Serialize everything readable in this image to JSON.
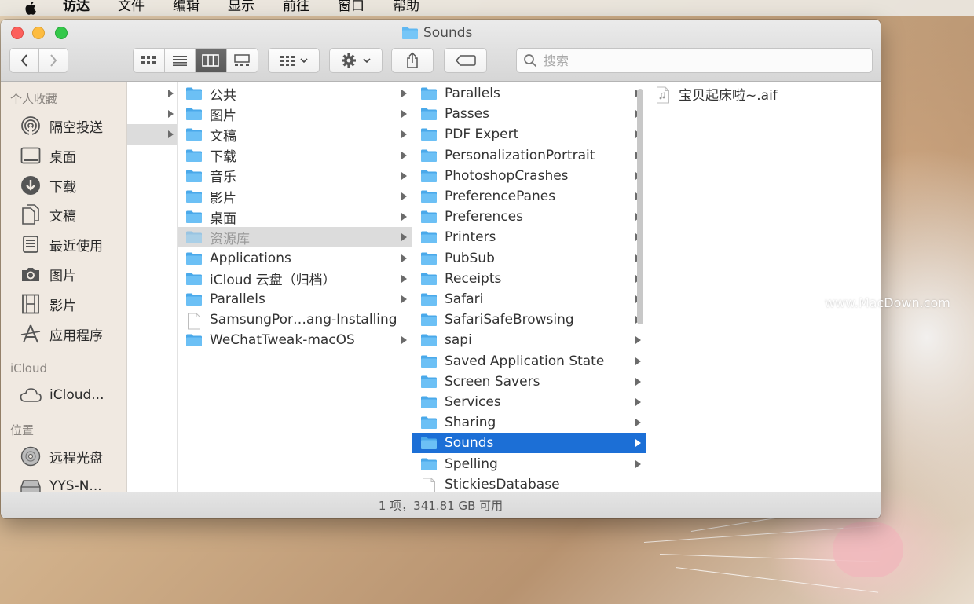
{
  "menubar": {
    "items": [
      "访达",
      "文件",
      "编辑",
      "显示",
      "前往",
      "窗口",
      "帮助"
    ]
  },
  "window": {
    "title": "Sounds"
  },
  "toolbar": {
    "search_placeholder": "搜索",
    "view_mode_active": "column"
  },
  "sidebar": {
    "sections": [
      {
        "header": "个人收藏",
        "items": [
          {
            "label": "隔空投送",
            "icon": "airdrop-icon"
          },
          {
            "label": "桌面",
            "icon": "desktop-icon"
          },
          {
            "label": "下载",
            "icon": "download-icon"
          },
          {
            "label": "文稿",
            "icon": "documents-icon"
          },
          {
            "label": "最近使用",
            "icon": "recents-icon"
          },
          {
            "label": "图片",
            "icon": "camera-icon"
          },
          {
            "label": "影片",
            "icon": "film-icon"
          },
          {
            "label": "应用程序",
            "icon": "applications-icon"
          }
        ]
      },
      {
        "header": "iCloud",
        "items": [
          {
            "label": "iCloud...",
            "icon": "cloud-icon"
          }
        ]
      },
      {
        "header": "位置",
        "items": [
          {
            "label": "远程光盘",
            "icon": "disc-icon"
          },
          {
            "label": "YYS-N...",
            "icon": "drive-icon"
          }
        ]
      }
    ]
  },
  "columns": {
    "col2": [
      {
        "name": "公共",
        "kind": "folder",
        "arrow": true
      },
      {
        "name": "图片",
        "kind": "folder",
        "arrow": true
      },
      {
        "name": "文稿",
        "kind": "folder",
        "arrow": true
      },
      {
        "name": "下载",
        "kind": "folder",
        "arrow": true
      },
      {
        "name": "音乐",
        "kind": "folder",
        "arrow": true
      },
      {
        "name": "影片",
        "kind": "folder",
        "arrow": true
      },
      {
        "name": "桌面",
        "kind": "folder",
        "arrow": true
      },
      {
        "name": "资源库",
        "kind": "folder",
        "arrow": true,
        "state": "selected-inactive"
      },
      {
        "name": "Applications",
        "kind": "folder",
        "arrow": true
      },
      {
        "name": "iCloud 云盘（归档）",
        "kind": "folder",
        "arrow": true
      },
      {
        "name": "Parallels",
        "kind": "folder",
        "arrow": true
      },
      {
        "name": "SamsungPor…ang-Installing",
        "kind": "file",
        "arrow": false
      },
      {
        "name": "WeChatTweak-macOS",
        "kind": "folder",
        "arrow": true
      }
    ],
    "col3": [
      {
        "name": "Parallels",
        "kind": "folder",
        "arrow": true
      },
      {
        "name": "Passes",
        "kind": "folder",
        "arrow": true
      },
      {
        "name": "PDF Expert",
        "kind": "folder",
        "arrow": true
      },
      {
        "name": "PersonalizationPortrait",
        "kind": "folder",
        "arrow": true
      },
      {
        "name": "PhotoshopCrashes",
        "kind": "folder",
        "arrow": true
      },
      {
        "name": "PreferencePanes",
        "kind": "folder",
        "arrow": true
      },
      {
        "name": "Preferences",
        "kind": "folder",
        "arrow": true
      },
      {
        "name": "Printers",
        "kind": "folder",
        "arrow": true
      },
      {
        "name": "PubSub",
        "kind": "folder",
        "arrow": true
      },
      {
        "name": "Receipts",
        "kind": "folder",
        "arrow": true
      },
      {
        "name": "Safari",
        "kind": "folder",
        "arrow": true
      },
      {
        "name": "SafariSafeBrowsing",
        "kind": "folder",
        "arrow": true
      },
      {
        "name": "sapi",
        "kind": "folder",
        "arrow": true
      },
      {
        "name": "Saved Application State",
        "kind": "folder",
        "arrow": true
      },
      {
        "name": "Screen Savers",
        "kind": "folder",
        "arrow": true
      },
      {
        "name": "Services",
        "kind": "folder",
        "arrow": true
      },
      {
        "name": "Sharing",
        "kind": "folder",
        "arrow": true
      },
      {
        "name": "Sounds",
        "kind": "folder",
        "arrow": true,
        "state": "selected-active"
      },
      {
        "name": "Spelling",
        "kind": "folder",
        "arrow": true
      },
      {
        "name": "StickiesDatabase",
        "kind": "file",
        "arrow": false
      }
    ],
    "col4": [
      {
        "name": "宝贝起床啦~.aif",
        "kind": "audio-file",
        "arrow": false
      }
    ]
  },
  "statusbar": {
    "text": "1 项，341.81 GB 可用"
  },
  "watermark": {
    "text": "www.MacDown.com"
  },
  "colors": {
    "selection_blue": "#1c6fd6",
    "folder_blue": "#5fb8f2",
    "sidebar_bg": "#f0e9e1"
  }
}
